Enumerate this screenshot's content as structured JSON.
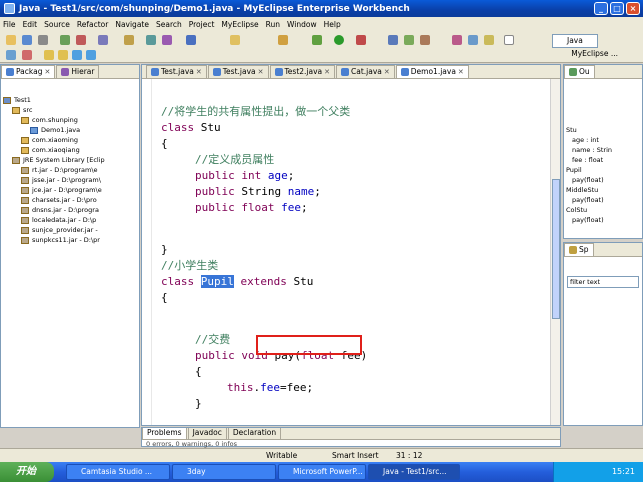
{
  "window": {
    "title": "Java - Test1/src/com/shunping/Demo1.java - MyEclipse Enterprise Workbench"
  },
  "menu": [
    "File",
    "Edit",
    "Source",
    "Refactor",
    "Navigate",
    "Search",
    "Project",
    "MyEclipse",
    "Run",
    "Window",
    "Help"
  ],
  "perspective": {
    "label": "Java",
    "secondary": "MyEclipse ..."
  },
  "left_tabs": [
    "Packag",
    "Hierar"
  ],
  "tree": [
    {
      "label": "Test1",
      "kind": "proj",
      "indent": 0
    },
    {
      "label": "src",
      "kind": "pkg",
      "indent": 1
    },
    {
      "label": "com.shunping",
      "kind": "pkg",
      "indent": 2
    },
    {
      "label": "Demo1.java",
      "kind": "java",
      "indent": 3
    },
    {
      "label": "com.xiaoming",
      "kind": "pkg",
      "indent": 2
    },
    {
      "label": "com.xiaoqiang",
      "kind": "pkg",
      "indent": 2
    },
    {
      "label": "JRE System Library [Eclip",
      "kind": "jar",
      "indent": 1
    },
    {
      "label": "rt.jar - D:\\program\\e",
      "kind": "jar",
      "indent": 2
    },
    {
      "label": "jsse.jar - D:\\program\\",
      "kind": "jar",
      "indent": 2
    },
    {
      "label": "jce.jar - D:\\program\\e",
      "kind": "jar",
      "indent": 2
    },
    {
      "label": "charsets.jar - D:\\pro",
      "kind": "jar",
      "indent": 2
    },
    {
      "label": "dnsns.jar - D:\\progra",
      "kind": "jar",
      "indent": 2
    },
    {
      "label": "localedata.jar - D:\\p",
      "kind": "jar",
      "indent": 2
    },
    {
      "label": "sunjce_provider.jar -",
      "kind": "jar",
      "indent": 2
    },
    {
      "label": "sunpkcs11.jar - D:\\pr",
      "kind": "jar",
      "indent": 2
    }
  ],
  "editor_tabs": [
    {
      "label": "Test.java",
      "active": false
    },
    {
      "label": "Test.java",
      "active": false
    },
    {
      "label": "Test2.java",
      "active": false
    },
    {
      "label": "Cat.java",
      "active": false
    },
    {
      "label": "Demo1.java",
      "active": true
    }
  ],
  "code": {
    "l1": "//将学生的共有属性提出，做一个父类",
    "l2_kw": "class",
    "l2_rest": " Stu",
    "l3": "{",
    "l4": "//定义成员属性",
    "l5_kw1": "public",
    "l5_kw2": " int",
    "l5_field": " age",
    "l5_end": ";",
    "l6_kw": "public",
    "l6_type": " String",
    "l6_field": " name",
    "l6_end": ";",
    "l7_kw1": "public",
    "l7_kw2": " float",
    "l7_field": " fee",
    "l7_end": ";",
    "l8": "}",
    "l9": "//小学生类",
    "l10_kw": "class",
    "l10_sel": "Pupil",
    "l10_ext": "extends",
    "l10_rest": " Stu",
    "l11": "{",
    "l12": "//交费",
    "l13_kw": "public",
    "l13_kw2": " void",
    "l13_rest": " pay(",
    "l13_kw3": "float",
    "l13_rest2": " fee)",
    "l14": "{",
    "l15_kw": "this",
    "l15_a": ".",
    "l15_f1": "fee",
    "l15_b": "=fee;",
    "l16": "}"
  },
  "outline": {
    "tab": "Ou",
    "items": [
      "Stu",
      "age : int",
      "name : Strin",
      "fee : float",
      "Pupil",
      "pay(float)",
      "MiddleStu",
      "pay(float)",
      "ColStu",
      "pay(float)"
    ]
  },
  "spell": {
    "tab": "Sp",
    "filter": "filter text"
  },
  "bottom_tabs": [
    "Problems",
    "Javadoc",
    "Declaration"
  ],
  "bottom_text": "0 errors, 0 warnings, 0 infos",
  "status": {
    "mode": "Writable",
    "insert": "Smart Insert",
    "pos": "31 : 12"
  },
  "taskbar": {
    "start": "开始",
    "tasks": [
      "Camtasia Studio ...",
      "3day",
      "Microsoft PowerP...",
      "Java - Test1/src..."
    ],
    "time": "15:21"
  }
}
